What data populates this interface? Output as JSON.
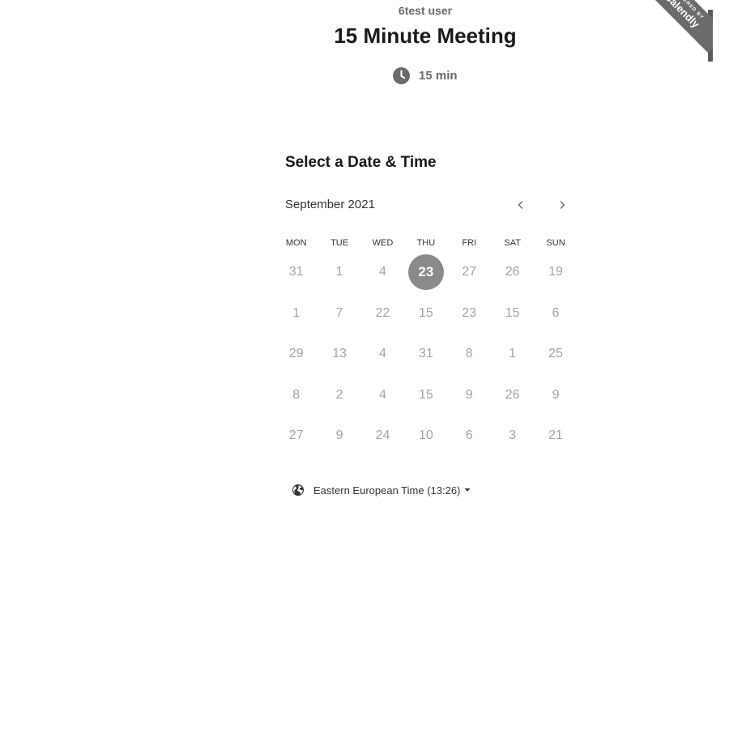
{
  "header": {
    "host_name": "6test user",
    "event_title": "15 Minute Meeting",
    "duration": "15 min"
  },
  "ribbon": {
    "small_text": "POWERED BY",
    "brand": "Calendly"
  },
  "scheduler": {
    "section_title": "Select a Date & Time",
    "month_label": "September 2021",
    "weekdays": [
      "MON",
      "TUE",
      "WED",
      "THU",
      "FRI",
      "SAT",
      "SUN"
    ],
    "weeks": [
      [
        "31",
        "1",
        "4",
        "23",
        "27",
        "26",
        "19"
      ],
      [
        "1",
        "7",
        "22",
        "15",
        "23",
        "15",
        "6"
      ],
      [
        "29",
        "13",
        "4",
        "31",
        "8",
        "1",
        "25"
      ],
      [
        "8",
        "2",
        "4",
        "15",
        "9",
        "26",
        "9"
      ],
      [
        "27",
        "9",
        "24",
        "10",
        "6",
        "3",
        "21"
      ]
    ],
    "selected_day": "23",
    "timezone": "Eastern European Time (13:26)"
  },
  "colors": {
    "selected_bg": "#8a8a8a",
    "day_text": "#a3a3a3",
    "ribbon": "#6b6b6b"
  },
  "icons": {
    "duration": "clock-icon",
    "prev": "chevron-left-icon",
    "next": "chevron-right-icon",
    "timezone": "globe-icon",
    "timezone_caret": "caret-down-icon"
  }
}
